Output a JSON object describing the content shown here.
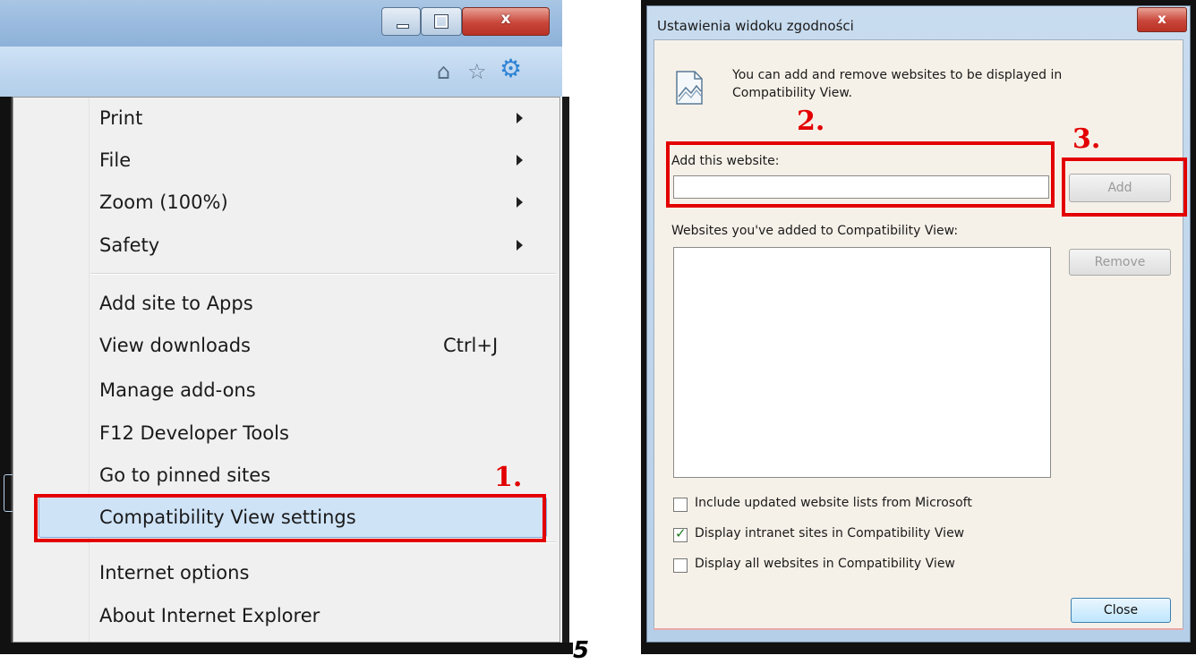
{
  "menu": {
    "items": [
      {
        "label": "Print",
        "has_submenu": true
      },
      {
        "label": "File",
        "has_submenu": true
      },
      {
        "label": "Zoom (100%)",
        "has_submenu": true
      },
      {
        "label": "Safety",
        "has_submenu": true
      },
      {
        "label": "Add site to Apps"
      },
      {
        "label": "View downloads",
        "shortcut": "Ctrl+J"
      },
      {
        "label": "Manage add-ons"
      },
      {
        "label": "F12 Developer Tools"
      },
      {
        "label": "Go to pinned sites"
      },
      {
        "label": "Compatibility View settings",
        "highlighted": true
      },
      {
        "label": "Internet options"
      },
      {
        "label": "About Internet Explorer"
      }
    ]
  },
  "caption": {
    "close": "x"
  },
  "annotations": {
    "step1": "1.",
    "step2": "2.",
    "step3": "3.",
    "page_number": "5"
  },
  "dialog": {
    "title": "Ustawienia widoku zgodności",
    "close": "x",
    "description_line1": "You can add and remove websites to be displayed in",
    "description_line2": "Compatibility View.",
    "add_label": "Add this website:",
    "add_input_value": "",
    "add_button": "Add",
    "list_label": "Websites you've added to Compatibility View:",
    "remove_button": "Remove",
    "checkboxes": [
      {
        "label": "Include updated website lists from Microsoft",
        "checked": false
      },
      {
        "label": "Display intranet sites in Compatibility View",
        "checked": true
      },
      {
        "label": "Display all websites in Compatibility View",
        "checked": false
      }
    ],
    "close_button": "Close"
  },
  "colors": {
    "annotation_red": "#e30000",
    "highlight": "#cfe3f7",
    "gear": "#2f84d4"
  }
}
